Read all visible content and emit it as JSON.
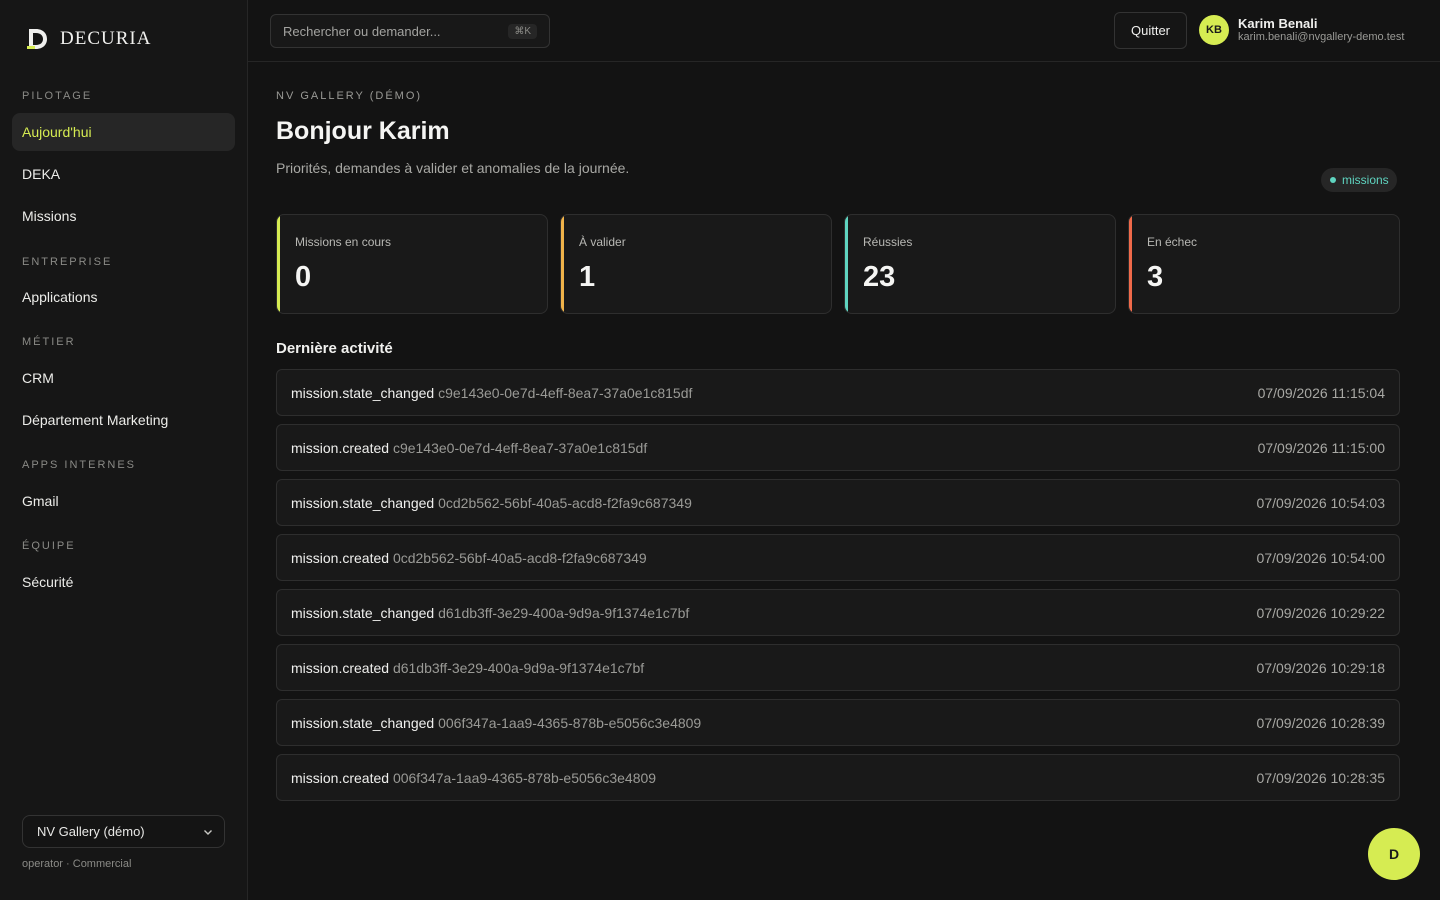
{
  "brand": {
    "name": "DECURIA",
    "logo_icon": "decuria-logo-icon"
  },
  "sidebar": {
    "sections": [
      {
        "label": "PILOTAGE",
        "items": [
          {
            "label": "Aujourd'hui",
            "active": true
          },
          {
            "label": "DEKA"
          },
          {
            "label": "Missions"
          }
        ]
      },
      {
        "label": "ENTREPRISE",
        "items": [
          {
            "label": "Applications"
          }
        ]
      },
      {
        "label": "MÉTIER",
        "items": [
          {
            "label": "CRM"
          },
          {
            "label": "Département Marketing"
          }
        ]
      },
      {
        "label": "APPS INTERNES",
        "items": [
          {
            "label": "Gmail"
          }
        ]
      },
      {
        "label": "ÉQUIPE",
        "items": [
          {
            "label": "Sécurité"
          }
        ]
      }
    ],
    "org_select": {
      "value": "NV Gallery (démo)"
    },
    "role_line": "operator · Commercial"
  },
  "topbar": {
    "search": {
      "placeholder": "Rechercher ou demander...",
      "shortcut": "⌘K"
    },
    "quit_label": "Quitter",
    "user": {
      "initials": "KB",
      "name": "Karim Benali",
      "email": "karim.benali@nvgallery-demo.test"
    }
  },
  "main": {
    "overline": "NV GALLERY (DÉMO)",
    "title": "Bonjour Karim",
    "subtitle": "Priorités, demandes à valider et anomalies de la journée.",
    "badge": "missions",
    "stats": [
      {
        "label": "Missions en cours",
        "value": "0",
        "color": "#d6ec52"
      },
      {
        "label": "À valider",
        "value": "1",
        "color": "#f0b34a"
      },
      {
        "label": "Réussies",
        "value": "23",
        "color": "#5fd4c0"
      },
      {
        "label": "En échec",
        "value": "3",
        "color": "#f06a4a"
      }
    ],
    "activity_title": "Dernière activité",
    "activity": [
      {
        "event": "mission.state_changed",
        "id": "c9e143e0-0e7d-4eff-8ea7-37a0e1c815df",
        "time": "07/09/2026 11:15:04"
      },
      {
        "event": "mission.created",
        "id": "c9e143e0-0e7d-4eff-8ea7-37a0e1c815df",
        "time": "07/09/2026 11:15:00"
      },
      {
        "event": "mission.state_changed",
        "id": "0cd2b562-56bf-40a5-acd8-f2fa9c687349",
        "time": "07/09/2026 10:54:03"
      },
      {
        "event": "mission.created",
        "id": "0cd2b562-56bf-40a5-acd8-f2fa9c687349",
        "time": "07/09/2026 10:54:00"
      },
      {
        "event": "mission.state_changed",
        "id": "d61db3ff-3e29-400a-9d9a-9f1374e1c7bf",
        "time": "07/09/2026 10:29:22"
      },
      {
        "event": "mission.created",
        "id": "d61db3ff-3e29-400a-9d9a-9f1374e1c7bf",
        "time": "07/09/2026 10:29:18"
      },
      {
        "event": "mission.state_changed",
        "id": "006f347a-1aa9-4365-878b-e5056c3e4809",
        "time": "07/09/2026 10:28:39"
      },
      {
        "event": "mission.created",
        "id": "006f347a-1aa9-4365-878b-e5056c3e4809",
        "time": "07/09/2026 10:28:35"
      }
    ]
  },
  "fab": {
    "label": "D"
  }
}
